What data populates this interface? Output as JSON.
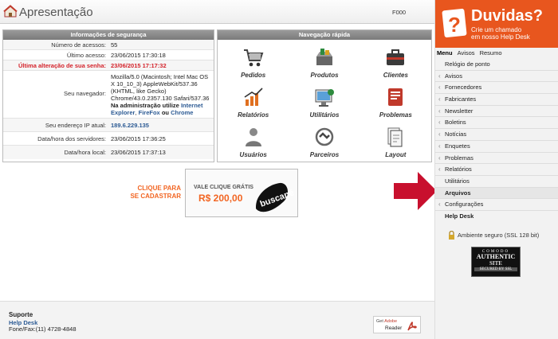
{
  "header": {
    "title": "Apresentação",
    "code": "F000"
  },
  "security": {
    "title": "Informações de segurança",
    "rows": [
      {
        "label": "Número de acessos:",
        "value": "55"
      },
      {
        "label": "Último acesso:",
        "value": "23/06/2015 17:30:18"
      },
      {
        "label": "Última alteração de sua senha:",
        "value": "23/06/2015 17:17:32"
      },
      {
        "label": "Seu navegador:",
        "value": "Mozilla/5.0 (Macintosh; Intel Mac OS X 10_10_3) AppleWebKit/537.36 (KHTML, like Gecko) Chrome/43.0.2357.130 Safari/537.36",
        "admin_text": "Na administração utilize",
        "link1": "Internet Explorer",
        "sep1": ",",
        "link2": "FireFox",
        "sep2": "ou",
        "link3": "Chrome"
      },
      {
        "label": "Seu endereço IP atual:",
        "value": "189.6.229.135"
      },
      {
        "label": "Data/hora dos servidores:",
        "value": "23/06/2015 17:36:25"
      },
      {
        "label": "Data/hora local:",
        "value": "23/06/2015 17:37:13"
      }
    ]
  },
  "nav": {
    "title": "Navegação rápida",
    "items": [
      {
        "label": "Pedidos",
        "icon": "cart-icon"
      },
      {
        "label": "Produtos",
        "icon": "products-icon"
      },
      {
        "label": "Clientes",
        "icon": "clients-icon"
      },
      {
        "label": "Relatórios",
        "icon": "chart-icon"
      },
      {
        "label": "Utilitários",
        "icon": "utilities-icon"
      },
      {
        "label": "Problemas",
        "icon": "problems-icon"
      },
      {
        "label": "Usuários",
        "icon": "user-icon"
      },
      {
        "label": "Parceiros",
        "icon": "partners-icon"
      },
      {
        "label": "Layout",
        "icon": "layout-icon"
      }
    ]
  },
  "promo": {
    "cta_line1": "CLIQUE PARA",
    "cta_line2": "SE CADASTRAR",
    "line1": "VALE CLIQUE GRÁTIS",
    "line2": "R$ 200,00",
    "brand": "buscapé"
  },
  "footer": {
    "title": "Suporte",
    "link": "Help Desk",
    "phone": "Fone/Fax:(11) 4728-4848",
    "adobe_get": "Get",
    "adobe_brand": "Adobe",
    "adobe_product": "Reader"
  },
  "sidebar": {
    "duvidas_title": "Duvidas?",
    "duvidas_sub1": "Crie um chamado",
    "duvidas_sub2": "em nosso Help Desk",
    "menu_tabs": [
      "Menu",
      "Avisos",
      "Resumo"
    ],
    "menu": [
      {
        "label": "Relógio de ponto",
        "sub": false,
        "bold": false
      },
      {
        "label": "Avisos",
        "sub": true,
        "bold": false
      },
      {
        "label": "Fornecedores",
        "sub": true,
        "bold": false
      },
      {
        "label": "Fabricantes",
        "sub": true,
        "bold": false
      },
      {
        "label": "Newsletter",
        "sub": true,
        "bold": false
      },
      {
        "label": "Boletins",
        "sub": true,
        "bold": false
      },
      {
        "label": "Notícias",
        "sub": true,
        "bold": false
      },
      {
        "label": "Enquetes",
        "sub": true,
        "bold": false
      },
      {
        "label": "Problemas",
        "sub": true,
        "bold": false
      },
      {
        "label": "Relatórios",
        "sub": true,
        "bold": false
      },
      {
        "label": "Utilitários",
        "sub": false,
        "bold": false
      },
      {
        "label": "Arquivos",
        "sub": false,
        "bold": true
      },
      {
        "label": "Configurações",
        "sub": true,
        "bold": false
      },
      {
        "label": "Help Desk",
        "sub": false,
        "bold": true
      }
    ],
    "secure_text": "Ambiente seguro (SSL 128 bit)",
    "seal": {
      "l1": "COMODO",
      "l2": "AUTHENTIC",
      "l3": "SITE",
      "l4": "SECURED BY SSL"
    }
  },
  "colors": {
    "accent": "#e8561e",
    "alert": "#d4232b",
    "link": "#2d5b94",
    "arrow": "#c8102e"
  }
}
